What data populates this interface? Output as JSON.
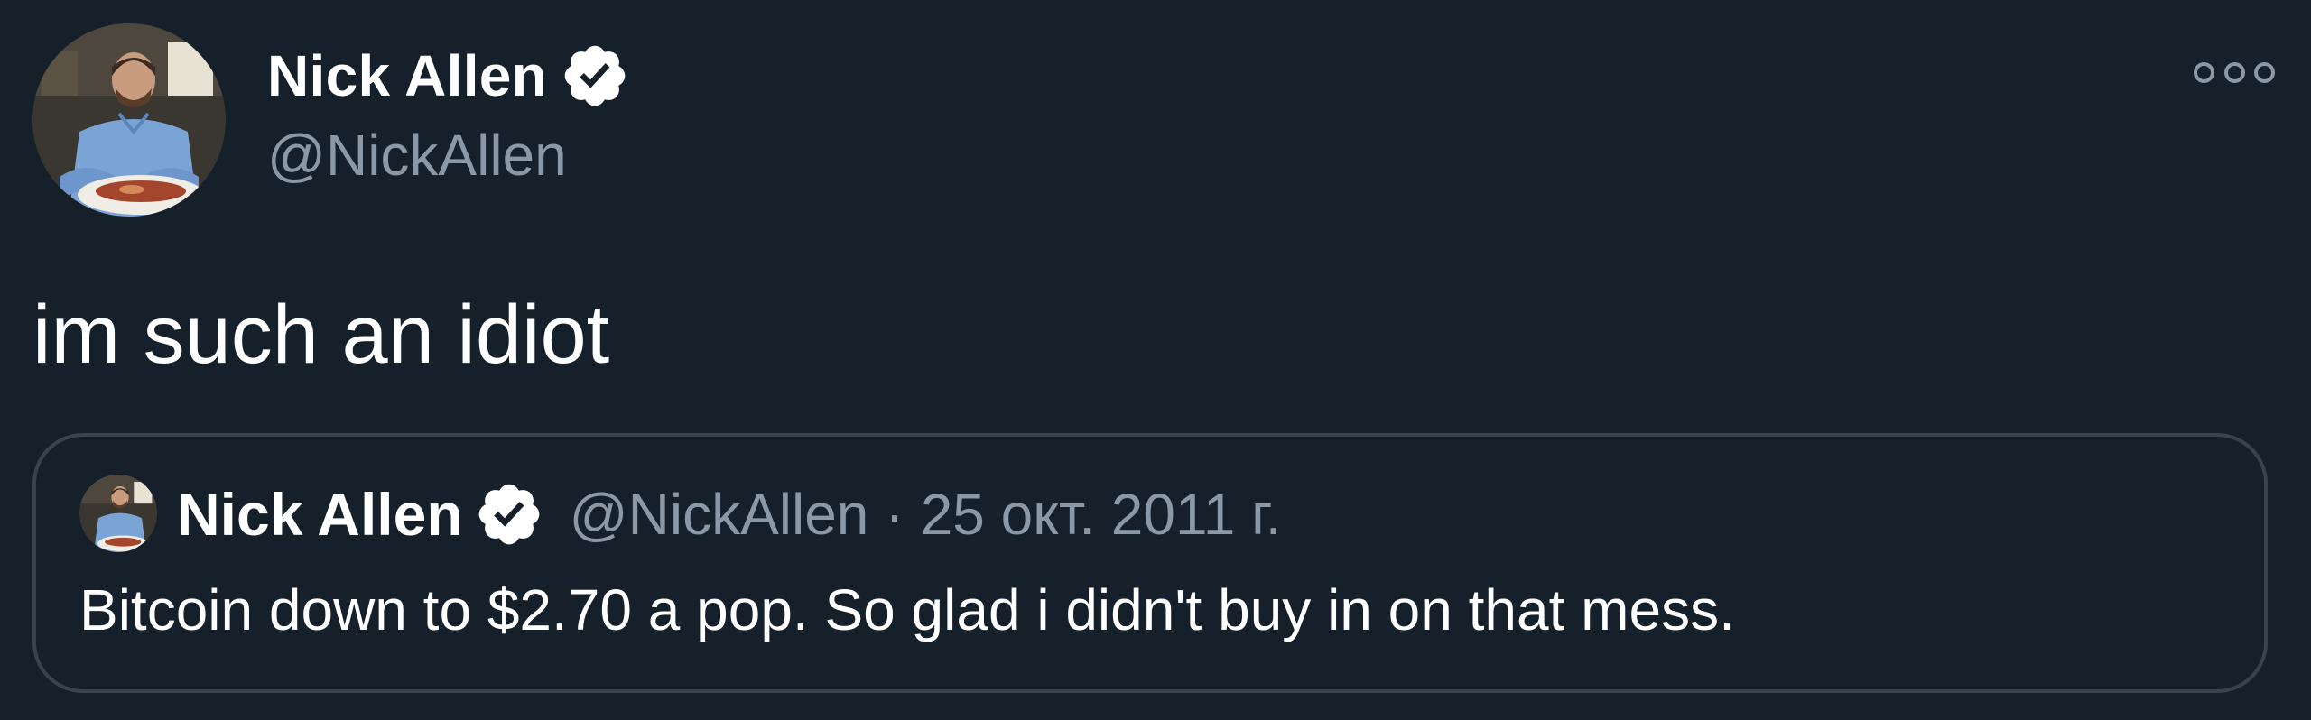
{
  "author": {
    "display_name": "Nick Allen",
    "handle": "@NickAllen",
    "verified_icon": "verified-badge-icon",
    "avatar_icon": "avatar-photo"
  },
  "tweet": {
    "text": "im such an idiot",
    "more_icon": "more-options-icon"
  },
  "quoted_tweet": {
    "display_name": "Nick Allen",
    "handle": "@NickAllen",
    "separator": "·",
    "date": "25 окт. 2011 г.",
    "text": "Bitcoin down to $2.70 a pop. So glad i didn't buy in on that mess."
  },
  "colors": {
    "background": "#15202b",
    "primary_text": "#ffffff",
    "secondary_text": "#8b98a5",
    "border": "#38444d"
  }
}
